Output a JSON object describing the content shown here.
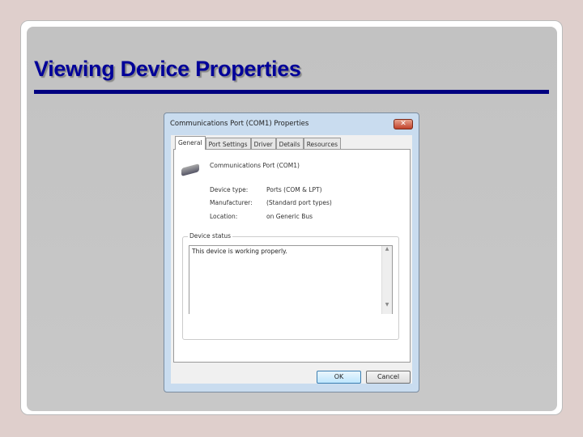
{
  "slide": {
    "title": "Viewing Device Properties"
  },
  "dialog": {
    "title": "Communications Port (COM1) Properties",
    "close_label": "✕",
    "tabs": [
      "General",
      "Port Settings",
      "Driver",
      "Details",
      "Resources"
    ],
    "device_name": "Communications Port (COM1)",
    "fields": [
      {
        "label": "Device type:",
        "value": "Ports (COM & LPT)"
      },
      {
        "label": "Manufacturer:",
        "value": "(Standard port types)"
      },
      {
        "label": "Location:",
        "value": "on Generic Bus"
      }
    ],
    "status_group": "Device status",
    "status_text": "This device is working properly.",
    "ok_label": "OK",
    "cancel_label": "Cancel"
  }
}
